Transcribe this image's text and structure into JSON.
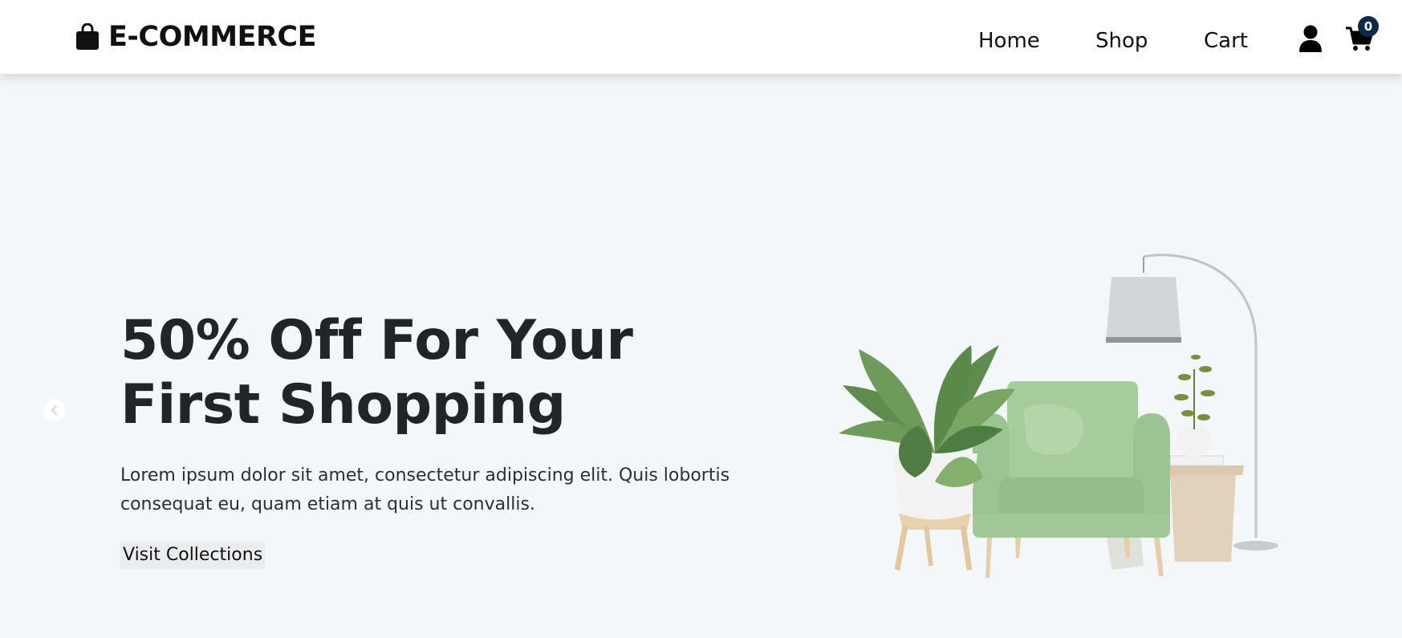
{
  "brand": {
    "name": "E-COMMERCE",
    "icon": "shopping-bag-icon"
  },
  "nav": {
    "links": [
      {
        "label": "Home"
      },
      {
        "label": "Shop"
      },
      {
        "label": "Cart"
      }
    ],
    "user_icon": "user-icon",
    "cart_icon": "shopping-cart-icon",
    "cart_count": "0"
  },
  "hero": {
    "title": "50% Off For Your First Shopping",
    "text": "Lorem ipsum dolor sit amet, consectetur adipiscing elit. Quis lobortis consequat eu, quam etiam at quis ut convallis.",
    "button_label": "Visit Collections",
    "prev_icon": "chevron-left-circle-icon",
    "image_icon": "armchair-plant-lamp-illustration"
  },
  "colors": {
    "navbar_bg": "#ffffff",
    "page_bg": "#f4f7fa",
    "text_dark": "#212529",
    "badge_bg": "#0b2b4d",
    "chair_green": "#9cc493",
    "button_bg": "#ebeced"
  }
}
